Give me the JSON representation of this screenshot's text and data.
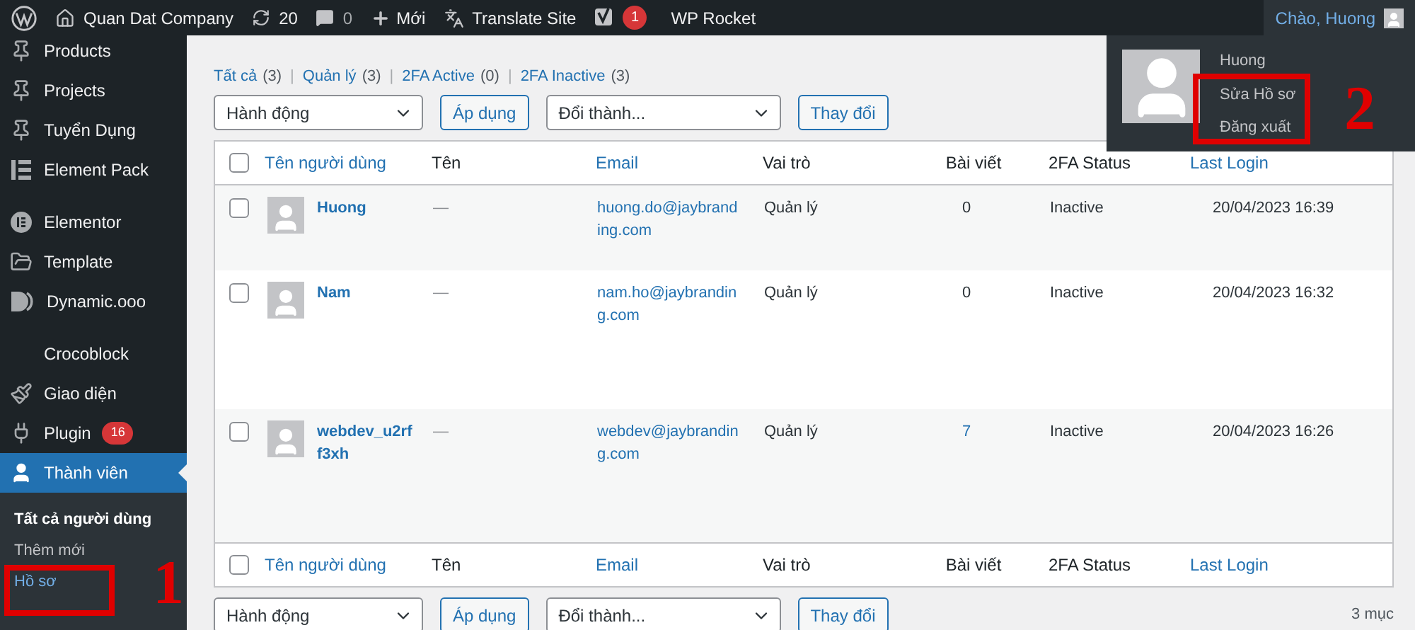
{
  "admin_bar": {
    "site": "Quan Dat Company",
    "updates": "20",
    "comments": "0",
    "new": "Mới",
    "translate": "Translate Site",
    "seo_badge": "1",
    "rocket": "WP Rocket",
    "greeting": "Chào, Huong"
  },
  "sidebar": {
    "items": [
      {
        "label": "Products",
        "selected": false
      },
      {
        "label": "Projects",
        "selected": false
      },
      {
        "label": "Tuyển Dụng",
        "selected": false
      },
      {
        "label": "Element Pack",
        "selected": false
      },
      {
        "label": "Elementor",
        "selected": false
      },
      {
        "label": "Template",
        "selected": false
      },
      {
        "label": "Dynamic.ooo",
        "selected": false
      },
      {
        "label": "Crocoblock",
        "selected": false
      },
      {
        "label": "Giao diện",
        "selected": false
      },
      {
        "label": "Plugin",
        "selected": false,
        "badge": "16"
      },
      {
        "label": "Thành viên",
        "selected": true
      }
    ],
    "submenu": [
      {
        "label": "Tất cả người dùng",
        "selected": true,
        "hovered": false
      },
      {
        "label": "Thêm mới",
        "selected": false,
        "hovered": false
      },
      {
        "label": "Hồ sơ",
        "selected": false,
        "hovered": true
      }
    ]
  },
  "filters": [
    {
      "label": "Tất cả",
      "count": "(3)"
    },
    {
      "separator": "|",
      "label": "Quản lý",
      "count": "(3)"
    },
    {
      "separator": "|",
      "label": "2FA Active",
      "count": "(0)"
    },
    {
      "separator": "|",
      "label": "2FA Inactive",
      "count": "(3)"
    }
  ],
  "top_actions": {
    "bulk": "Hành động",
    "apply": "Áp dụng",
    "role": "Đổi thành...",
    "change": "Thay đổi"
  },
  "table": {
    "select_all": {
      "checked": false
    },
    "footer_select_all": {
      "checked": false
    },
    "footer_columns": [
      {
        "label": "Tên người dùng",
        "sortable": true
      },
      {
        "label": "Tên",
        "sortable": false
      },
      {
        "label": "Email",
        "sortable": true
      },
      {
        "label": "Vai trò",
        "sortable": false
      },
      {
        "label": "Bài viết",
        "sortable": false
      },
      {
        "label": "2FA Status",
        "sortable": false
      },
      {
        "label": "Last Login",
        "sortable": true
      }
    ],
    "columns": [
      {
        "label": "Tên người dùng",
        "sortable": true
      },
      {
        "label": "Tên",
        "sortable": false
      },
      {
        "label": "Email",
        "sortable": true
      },
      {
        "label": "Vai trò",
        "sortable": false
      },
      {
        "label": "Bài viết",
        "sortable": false
      },
      {
        "label": "2FA Status",
        "sortable": false
      },
      {
        "label": "Last Login",
        "sortable": true
      }
    ],
    "rows": [
      {
        "username": "Huong",
        "name": "—",
        "email": "huong.do@jaybranding.com",
        "role": "Quản lý",
        "posts": "0",
        "posts_linked": false,
        "status": "Inactive",
        "last_login": "20/04/2023 16:39",
        "checked": false
      },
      {
        "username": "Nam",
        "name": "—",
        "email": "nam.ho@jaybranding.com",
        "role": "Quản lý",
        "posts": "0",
        "posts_linked": false,
        "status": "Inactive",
        "last_login": "20/04/2023 16:32",
        "checked": false
      },
      {
        "username": "webdev_u2rff3xh",
        "name": "—",
        "email": "webdev@jaybranding.com",
        "role": "Quản lý",
        "posts": "7",
        "posts_linked": true,
        "status": "Inactive",
        "last_login": "20/04/2023 16:26",
        "checked": false
      }
    ]
  },
  "bottom_actions": {
    "bulk": "Hành động",
    "apply": "Áp dụng",
    "role": "Đổi thành...",
    "change": "Thay đổi",
    "count": "3 mục"
  },
  "user_menu": {
    "name": "Huong",
    "items": [
      "Sửa Hồ sơ",
      "Đăng xuất"
    ]
  },
  "annotations": [
    {
      "label": "1"
    },
    {
      "label": "2"
    }
  ]
}
